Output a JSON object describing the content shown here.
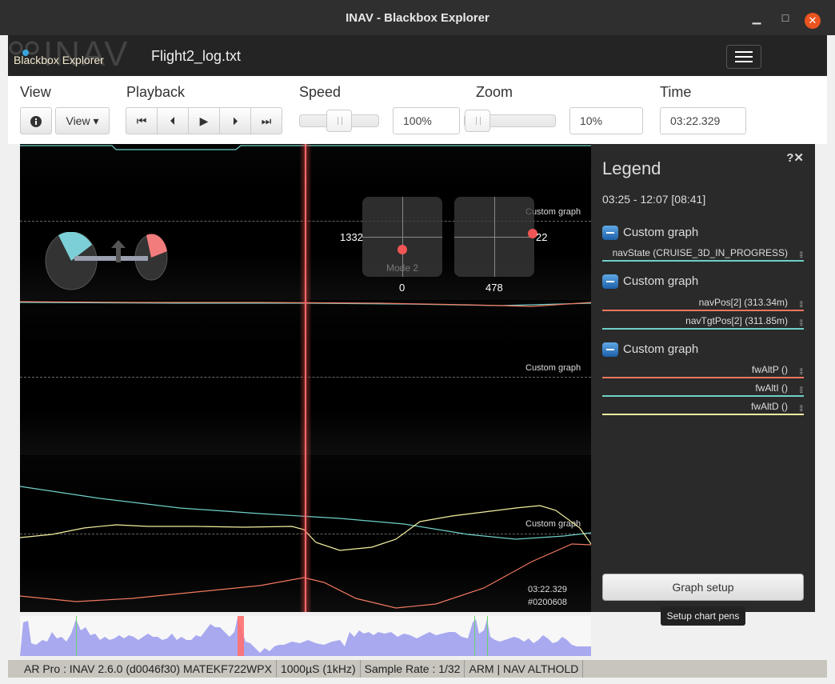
{
  "window": {
    "title": "INAV - Blackbox Explorer",
    "minimize": "▁",
    "maximize": "□",
    "close": "✕"
  },
  "header": {
    "logo": "INAV",
    "app_name": "Blackbox Explorer",
    "file_name": "Flight2_log.txt",
    "menu_icon": "hamburger-icon"
  },
  "toolbar": {
    "view_label": "View",
    "info_icon": "info-icon",
    "view_button": "View ▾",
    "playback_label": "Playback",
    "playback_buttons": [
      "⏮",
      "⏴",
      "▶",
      "⏵",
      "⏭"
    ],
    "speed_label": "Speed",
    "speed_value": "100%",
    "zoom_label": "Zoom",
    "zoom_value": "10%",
    "time_label": "Time",
    "time_value": "03:22.329"
  },
  "graph": {
    "panel_labels": [
      "Custom graph",
      "Custom graph",
      "Custom graph"
    ],
    "stick_left": {
      "left_value": "1332",
      "bottom_value": "0",
      "mode": "Mode 2"
    },
    "stick_right": {
      "right_value": "22",
      "bottom_value": "478"
    },
    "cursor_time": "03:22.329",
    "cursor_frame": "#0200608"
  },
  "legend": {
    "title": "Legend",
    "range": "03:25 - 12:07 [08:41]",
    "groups": [
      {
        "name": "Custom graph",
        "fields": [
          {
            "label": "navState (CRUISE_3D_IN_PROGRESS)",
            "color": "#6fd0c8"
          }
        ]
      },
      {
        "name": "Custom graph",
        "fields": [
          {
            "label": "navPos[2] (313.34m)",
            "color": "#f07860"
          },
          {
            "label": "navTgtPos[2] (311.85m)",
            "color": "#6fd0c8"
          }
        ]
      },
      {
        "name": "Custom graph",
        "fields": [
          {
            "label": "fwAltP ()",
            "color": "#f07860"
          },
          {
            "label": "fwAltI ()",
            "color": "#6fd0c8"
          },
          {
            "label": "fwAltD ()",
            "color": "#f4f0a0"
          }
        ]
      }
    ],
    "graph_setup": "Graph setup",
    "tooltip": "Setup chart pens"
  },
  "status": {
    "craft": "AR Pro : INAV 2.6.0 (d0046f30) MATEKF722WPX",
    "looptime": "1000µS (1kHz)",
    "sample_rate": "Sample Rate : 1/32",
    "flight_mode": "ARM | NAV ALTHOLD"
  }
}
